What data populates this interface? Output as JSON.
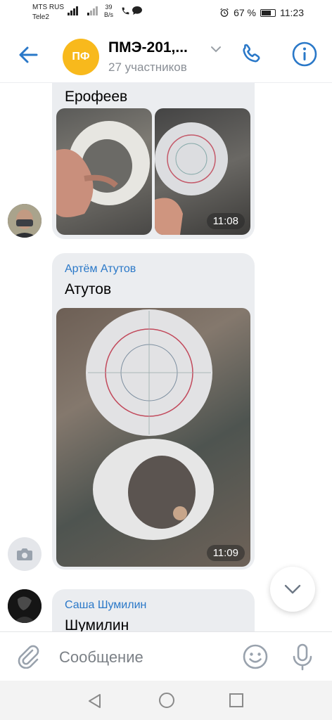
{
  "status_bar": {
    "carrier1": "MTS RUS",
    "carrier2": "Tele2",
    "speed_value": "39",
    "speed_unit": "B/s",
    "battery_percent": "67 %",
    "battery_level": 0.67,
    "time": "11:23"
  },
  "header": {
    "back_icon": "arrow-left-icon",
    "avatar_initials": "ПФ",
    "avatar_color": "#f8b91c",
    "title": "ПМЭ-201,...",
    "subtitle": "27 участников",
    "call_icon": "phone-icon",
    "info_icon": "info-icon",
    "accent_color": "#2a78c8"
  },
  "messages": [
    {
      "text": "Ерофеев",
      "photos": [
        {
          "desc_icon": "photo-icon",
          "time": ""
        },
        {
          "desc_icon": "photo-icon",
          "time": "11:08"
        }
      ]
    },
    {
      "sender": "Артём Атутов",
      "text": "Атутов",
      "photos": [
        {
          "desc_icon": "photo-icon",
          "time": "11:09"
        }
      ]
    },
    {
      "sender": "Саша Шумилин",
      "text": "Шумилин"
    }
  ],
  "input_bar": {
    "placeholder": "Сообщение",
    "value": "",
    "attach_icon": "paperclip-icon",
    "emoji_icon": "smile-icon",
    "mic_icon": "microphone-icon"
  },
  "nav_bar": {
    "back_icon": "triangle-back-icon",
    "home_icon": "circle-home-icon",
    "recent_icon": "square-recent-icon"
  }
}
